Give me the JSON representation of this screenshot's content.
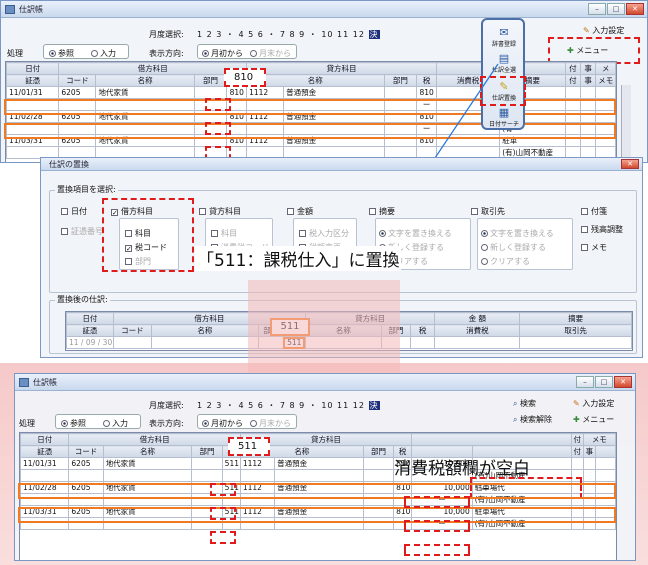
{
  "top_window": {
    "title": "仕訳帳",
    "month_label": "月度選択:",
    "months": "1 2 3 ・ 4 5 6 ・ 7 8 9 ・ 10 11 12",
    "month_selected": "決",
    "mode_label": "処理",
    "mode_ref": "参照",
    "mode_input": "入力",
    "dir_label": "表示方向:",
    "dir_start": "月初から",
    "dir_end": "月末から",
    "input_settings": "入力設定",
    "menu": "メニュー",
    "fu": "付",
    "ji": "事",
    "me": "メ",
    "header1": [
      "日付",
      "借方科目",
      "貸方科目",
      "金 額"
    ],
    "header2": [
      "証憑",
      "コード",
      "名称",
      "部門",
      "税",
      "名称",
      "部門",
      "税",
      "消費税",
      "摘要",
      "付",
      "事",
      "メモ"
    ],
    "tax_code_old": "810",
    "rows": [
      {
        "date": "11/01/31",
        "code": "6205",
        "name": "地代家賃",
        "tax": "810",
        "code2": "1112",
        "name2": "普通預金",
        "tax2": "810",
        "memo": "駐車",
        "memo2": "(有"
      },
      {
        "date": "11/02/28",
        "code": "6205",
        "name": "地代家賃",
        "tax": "810",
        "code2": "1112",
        "name2": "普通預金",
        "tax2": "810",
        "memo": "駐車",
        "memo2": "(有"
      },
      {
        "date": "11/03/31",
        "code": "6205",
        "name": "地代家賃",
        "tax": "810",
        "code2": "1112",
        "name2": "普通預金",
        "tax2": "810",
        "memo": "駐車",
        "memo2": "(有)山岡不動産"
      }
    ],
    "dash": "ー"
  },
  "toolbar_popup": {
    "item1": "辞書登録",
    "item2": "仕訳全選",
    "item3": "仕訳置換",
    "item4": "日付サーチ"
  },
  "replace_dialog": {
    "title": "仕訳の置換",
    "select_items_label": "置換項目を選択:",
    "date": "日付",
    "voucher": "証憑番号",
    "debit_account": "借方科目",
    "sub_account": "科目",
    "tax_code": "税コード",
    "department": "部門",
    "credit_account": "貸方科目",
    "credit_sub": "科目",
    "credit_tax": "消費税コード",
    "credit_dept": "部門",
    "amount": "金額",
    "tax_input": "税入力区分",
    "tax_change": "税額変更",
    "summary": "摘要",
    "replace_text": "文字を置き換える",
    "new_register": "新しく登録する",
    "clear_it": "クリアする",
    "partner": "取引先",
    "replace_text2": "文字を置き換える",
    "new_register2": "新しく登録する",
    "clear_it2": "クリアする",
    "attached": "付箋",
    "balance_adjust": "残高調整",
    "memo": "メモ",
    "after_label": "置換後の仕訳:",
    "header1": [
      "日付",
      "借方科目",
      "貸方科目",
      "金 額",
      "摘要"
    ],
    "header2": [
      "証憑",
      "コード",
      "名称",
      "部門",
      "税",
      "名称",
      "部門",
      "税",
      "消費税",
      "取引先"
    ],
    "new_tax_code": "511",
    "row_date": "11 / 09 / 30",
    "row_tax": "511"
  },
  "annotation_top": "「511：課税仕入」に置換",
  "annotation_bottom": "消費税額欄が空白",
  "bottom_window": {
    "title": "仕訳帳",
    "month_label": "月度選択:",
    "months": "1 2 3 ・ 4 5 6 ・ 7 8 9 ・ 10 11 12",
    "month_selected": "決",
    "mode_label": "処理",
    "mode_ref": "参照",
    "mode_input": "入力",
    "dir_label": "表示方向:",
    "dir_start": "月初から",
    "dir_end": "月末から",
    "search": "検索",
    "search_clear": "検索解除",
    "input_settings": "入力設定",
    "menu": "メニュー",
    "tax_code_new": "511",
    "fu": "付",
    "me": "メモ",
    "ji": "事",
    "rows": [
      {
        "date": "11/01/31",
        "code": "6205",
        "name": "地代家賃",
        "tax": "511",
        "code2": "1112",
        "name2": "普通預金",
        "tax2": "810",
        "amount": "10,000",
        "memo": "(有)山岡不動産"
      },
      {
        "date": "11/02/28",
        "code": "6205",
        "name": "地代家賃",
        "tax": "511",
        "code2": "1112",
        "name2": "普通預金",
        "tax2": "810",
        "amount": "10,000",
        "memo": "駐車場代",
        "memo2": "(有)山岡不動産"
      },
      {
        "date": "11/03/31",
        "code": "6205",
        "name": "地代家賃",
        "tax": "511",
        "code2": "1112",
        "name2": "普通預金",
        "tax2": "810",
        "amount": "10,000",
        "memo": "駐車場代",
        "memo2": "(有)山岡不動産"
      }
    ],
    "dash": "ー"
  }
}
